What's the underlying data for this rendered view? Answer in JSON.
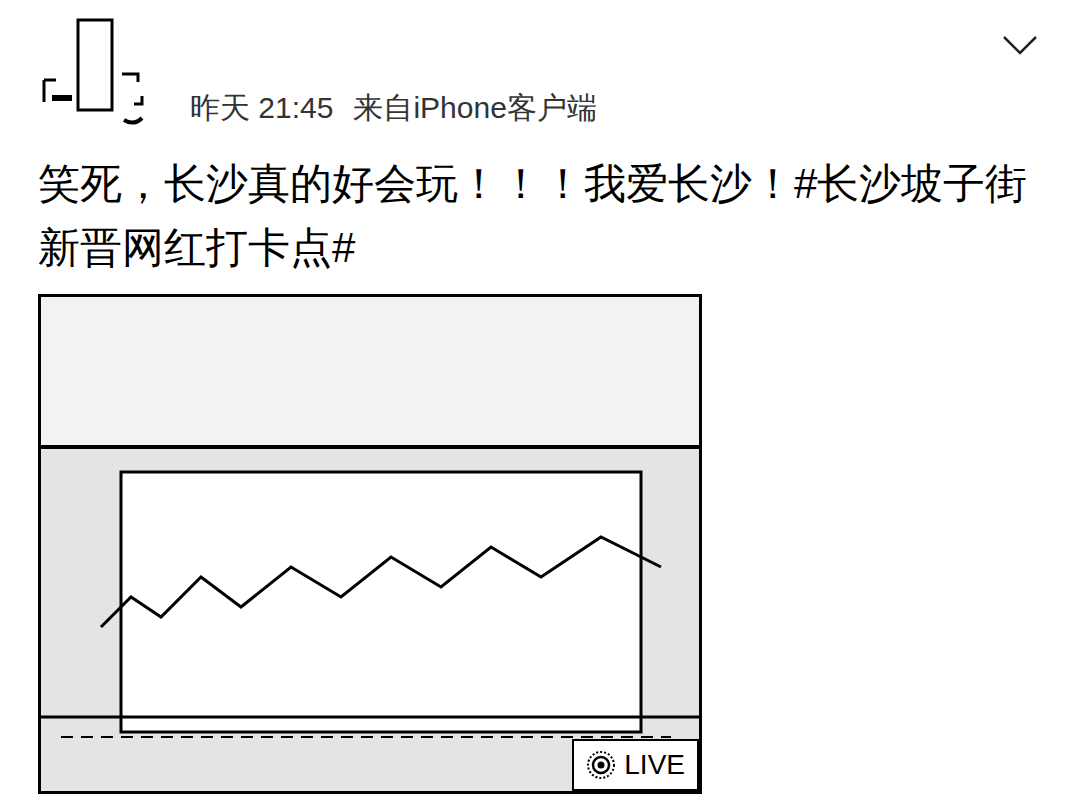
{
  "post": {
    "time": "昨天 21:45",
    "source": "来自iPhone客户端",
    "text": "笑死，长沙真的好会玩！！！我爱长沙！#长沙坡子街新晋网红打卡点#"
  },
  "photo": {
    "badge": "LIVE"
  }
}
